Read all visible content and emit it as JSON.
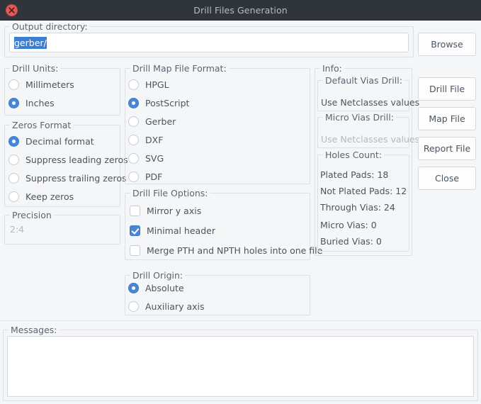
{
  "window": {
    "title": "Drill Files Generation",
    "close_icon": "close-icon"
  },
  "output_directory": {
    "label": "Output directory:",
    "value": "gerber/",
    "browse_label": "Browse"
  },
  "drill_units": {
    "label": "Drill Units:",
    "options": [
      {
        "label": "Millimeters",
        "selected": false
      },
      {
        "label": "Inches",
        "selected": true
      }
    ]
  },
  "zeros_format": {
    "label": "Zeros Format",
    "options": [
      {
        "label": "Decimal format",
        "selected": true
      },
      {
        "label": "Suppress leading zeros",
        "selected": false
      },
      {
        "label": "Suppress trailing zeros",
        "selected": false
      },
      {
        "label": "Keep zeros",
        "selected": false
      }
    ]
  },
  "precision": {
    "label": "Precision",
    "value": "2:4"
  },
  "drill_map_file_format": {
    "label": "Drill Map File Format:",
    "options": [
      {
        "label": "HPGL",
        "selected": false
      },
      {
        "label": "PostScript",
        "selected": true
      },
      {
        "label": "Gerber",
        "selected": false
      },
      {
        "label": "DXF",
        "selected": false
      },
      {
        "label": "SVG",
        "selected": false
      },
      {
        "label": "PDF",
        "selected": false
      }
    ]
  },
  "drill_file_options": {
    "label": "Drill File Options:",
    "options": [
      {
        "label": "Mirror y axis",
        "checked": false
      },
      {
        "label": "Minimal header",
        "checked": true
      },
      {
        "label": "Merge PTH and NPTH holes into one file",
        "checked": false
      }
    ]
  },
  "drill_origin": {
    "label": "Drill Origin:",
    "options": [
      {
        "label": "Absolute",
        "selected": true
      },
      {
        "label": "Auxiliary axis",
        "selected": false
      }
    ]
  },
  "info": {
    "label": "Info:",
    "default_vias_drill": {
      "label": "Default Vias Drill:",
      "value": "Use Netclasses values"
    },
    "micro_vias_drill": {
      "label": "Micro Vias Drill:",
      "value": "Use Netclasses values"
    },
    "holes_count": {
      "label": "Holes Count:",
      "items": [
        "Plated Pads: 18",
        "Not Plated Pads: 12",
        "Through Vias: 24",
        "Micro Vias: 0",
        "Buried Vias: 0"
      ]
    }
  },
  "actions": {
    "drill_file": "Drill File",
    "map_file": "Map File",
    "report_file": "Report File",
    "close": "Close"
  },
  "messages": {
    "label": "Messages:",
    "value": ""
  },
  "colors": {
    "accent": "#4a86d6",
    "selection": "#3b7fd4",
    "titlebar": "#30353b",
    "close": "#e25b5b"
  }
}
